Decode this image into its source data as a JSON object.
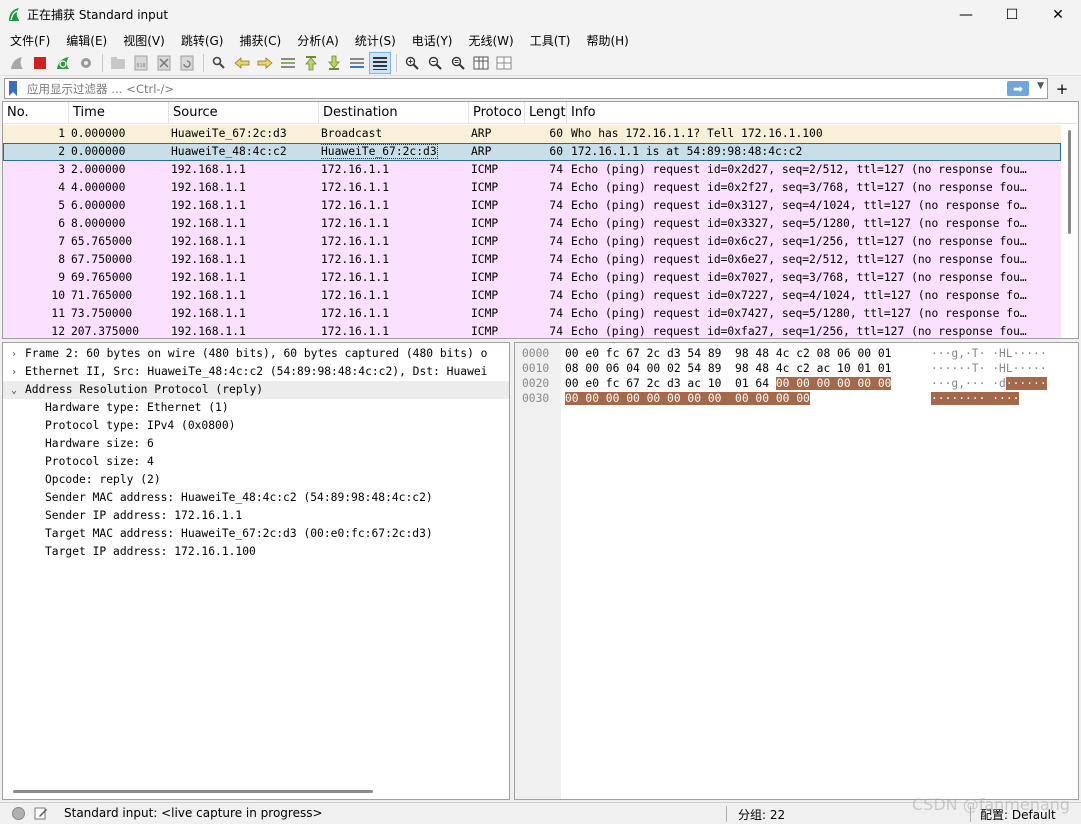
{
  "window": {
    "title": "正在捕获 Standard input",
    "minimize": "—",
    "maximize": "☐",
    "close": "✕"
  },
  "menu": [
    "文件(F)",
    "编辑(E)",
    "视图(V)",
    "跳转(G)",
    "捕获(C)",
    "分析(A)",
    "统计(S)",
    "电话(Y)",
    "无线(W)",
    "工具(T)",
    "帮助(H)"
  ],
  "filter": {
    "placeholder": "应用显示过滤器 … <Ctrl-/>",
    "apply_icon": "arrow-right-icon",
    "add_label": "+"
  },
  "packet_list": {
    "columns": [
      "No.",
      "Time",
      "Source",
      "Destination",
      "Protoco",
      "Lengt",
      "Info"
    ],
    "rows": [
      {
        "no": "1",
        "time": "0.000000",
        "src": "HuaweiTe_67:2c:d3",
        "dst": "Broadcast",
        "proto": "ARP",
        "len": "60",
        "info": "Who has 172.16.1.1? Tell 172.16.1.100",
        "kind": "arp"
      },
      {
        "no": "2",
        "time": "0.000000",
        "src": "HuaweiTe_48:4c:c2",
        "dst": "HuaweiTe_67:2c:d3",
        "proto": "ARP",
        "len": "60",
        "info": "172.16.1.1 is at 54:89:98:48:4c:c2",
        "kind": "selected"
      },
      {
        "no": "3",
        "time": "2.000000",
        "src": "192.168.1.1",
        "dst": "172.16.1.1",
        "proto": "ICMP",
        "len": "74",
        "info": "Echo (ping) request  id=0x2d27, seq=2/512, ttl=127 (no response fou…",
        "kind": "icmp"
      },
      {
        "no": "4",
        "time": "4.000000",
        "src": "192.168.1.1",
        "dst": "172.16.1.1",
        "proto": "ICMP",
        "len": "74",
        "info": "Echo (ping) request  id=0x2f27, seq=3/768, ttl=127 (no response fou…",
        "kind": "icmp"
      },
      {
        "no": "5",
        "time": "6.000000",
        "src": "192.168.1.1",
        "dst": "172.16.1.1",
        "proto": "ICMP",
        "len": "74",
        "info": "Echo (ping) request  id=0x3127, seq=4/1024, ttl=127 (no response fo…",
        "kind": "icmp"
      },
      {
        "no": "6",
        "time": "8.000000",
        "src": "192.168.1.1",
        "dst": "172.16.1.1",
        "proto": "ICMP",
        "len": "74",
        "info": "Echo (ping) request  id=0x3327, seq=5/1280, ttl=127 (no response fo…",
        "kind": "icmp"
      },
      {
        "no": "7",
        "time": "65.765000",
        "src": "192.168.1.1",
        "dst": "172.16.1.1",
        "proto": "ICMP",
        "len": "74",
        "info": "Echo (ping) request  id=0x6c27, seq=1/256, ttl=127 (no response fou…",
        "kind": "icmp"
      },
      {
        "no": "8",
        "time": "67.750000",
        "src": "192.168.1.1",
        "dst": "172.16.1.1",
        "proto": "ICMP",
        "len": "74",
        "info": "Echo (ping) request  id=0x6e27, seq=2/512, ttl=127 (no response fou…",
        "kind": "icmp"
      },
      {
        "no": "9",
        "time": "69.765000",
        "src": "192.168.1.1",
        "dst": "172.16.1.1",
        "proto": "ICMP",
        "len": "74",
        "info": "Echo (ping) request  id=0x7027, seq=3/768, ttl=127 (no response fou…",
        "kind": "icmp"
      },
      {
        "no": "10",
        "time": "71.765000",
        "src": "192.168.1.1",
        "dst": "172.16.1.1",
        "proto": "ICMP",
        "len": "74",
        "info": "Echo (ping) request  id=0x7227, seq=4/1024, ttl=127 (no response fo…",
        "kind": "icmp"
      },
      {
        "no": "11",
        "time": "73.750000",
        "src": "192.168.1.1",
        "dst": "172.16.1.1",
        "proto": "ICMP",
        "len": "74",
        "info": "Echo (ping) request  id=0x7427, seq=5/1280, ttl=127 (no response fo…",
        "kind": "icmp"
      },
      {
        "no": "12",
        "time": "207.375000",
        "src": "192.168.1.1",
        "dst": "172.16.1.1",
        "proto": "ICMP",
        "len": "74",
        "info": "Echo (ping) request  id=0xfa27, seq=1/256, ttl=127 (no response fou…",
        "kind": "icmp"
      }
    ]
  },
  "details": [
    {
      "arrow": "›",
      "text": "Frame 2: 60 bytes on wire (480 bits), 60 bytes captured (480 bits) o",
      "indent": 0
    },
    {
      "arrow": "›",
      "text": "Ethernet II, Src: HuaweiTe_48:4c:c2 (54:89:98:48:4c:c2), Dst: Huawei",
      "indent": 0
    },
    {
      "arrow": "⌄",
      "text": "Address Resolution Protocol (reply)",
      "indent": 0,
      "selected": true
    },
    {
      "arrow": "",
      "text": "Hardware type: Ethernet (1)",
      "indent": 1
    },
    {
      "arrow": "",
      "text": "Protocol type: IPv4 (0x0800)",
      "indent": 1
    },
    {
      "arrow": "",
      "text": "Hardware size: 6",
      "indent": 1
    },
    {
      "arrow": "",
      "text": "Protocol size: 4",
      "indent": 1
    },
    {
      "arrow": "",
      "text": "Opcode: reply (2)",
      "indent": 1
    },
    {
      "arrow": "",
      "text": "Sender MAC address: HuaweiTe_48:4c:c2 (54:89:98:48:4c:c2)",
      "indent": 1
    },
    {
      "arrow": "",
      "text": "Sender IP address: 172.16.1.1",
      "indent": 1
    },
    {
      "arrow": "",
      "text": "Target MAC address: HuaweiTe_67:2c:d3 (00:e0:fc:67:2c:d3)",
      "indent": 1
    },
    {
      "arrow": "",
      "text": "Target IP address: 172.16.1.100",
      "indent": 1
    }
  ],
  "bytes": {
    "offsets": [
      "0000",
      "0010",
      "0020",
      "0030"
    ],
    "hex": [
      {
        "plain": "00 e0 fc 67 2c d3 54 89  98 48 4c c2 08 06 00 01",
        "hl": ""
      },
      {
        "plain": "08 00 06 04 00 02 54 89  98 48 4c c2 ac 10 01 01",
        "hl": ""
      },
      {
        "plain": "00 e0 fc 67 2c d3 ac 10  01 64 ",
        "hl": "00 00 00 00 00 00"
      },
      {
        "plain": "",
        "hl": "00 00 00 00 00 00 00 00  00 00 00 00"
      }
    ],
    "ascii": [
      {
        "plain": "···g,·T· ·HL·····",
        "hl": ""
      },
      {
        "plain": "······T· ·HL·····",
        "hl": ""
      },
      {
        "plain": "···g,··· ·d",
        "hl": "······"
      },
      {
        "plain": "",
        "hl": "········ ····"
      }
    ]
  },
  "status": {
    "capture_text": "Standard input: <live capture in progress>",
    "packets": "分组: 22",
    "profile": "配置: Default"
  },
  "watermark": "CSDN @fanmenang",
  "colors": {
    "arp_row": "#faf0d7",
    "icmp_row": "#fce0ff",
    "selected_row": "#c9dee8",
    "byte_highlight": "#a4684a"
  }
}
